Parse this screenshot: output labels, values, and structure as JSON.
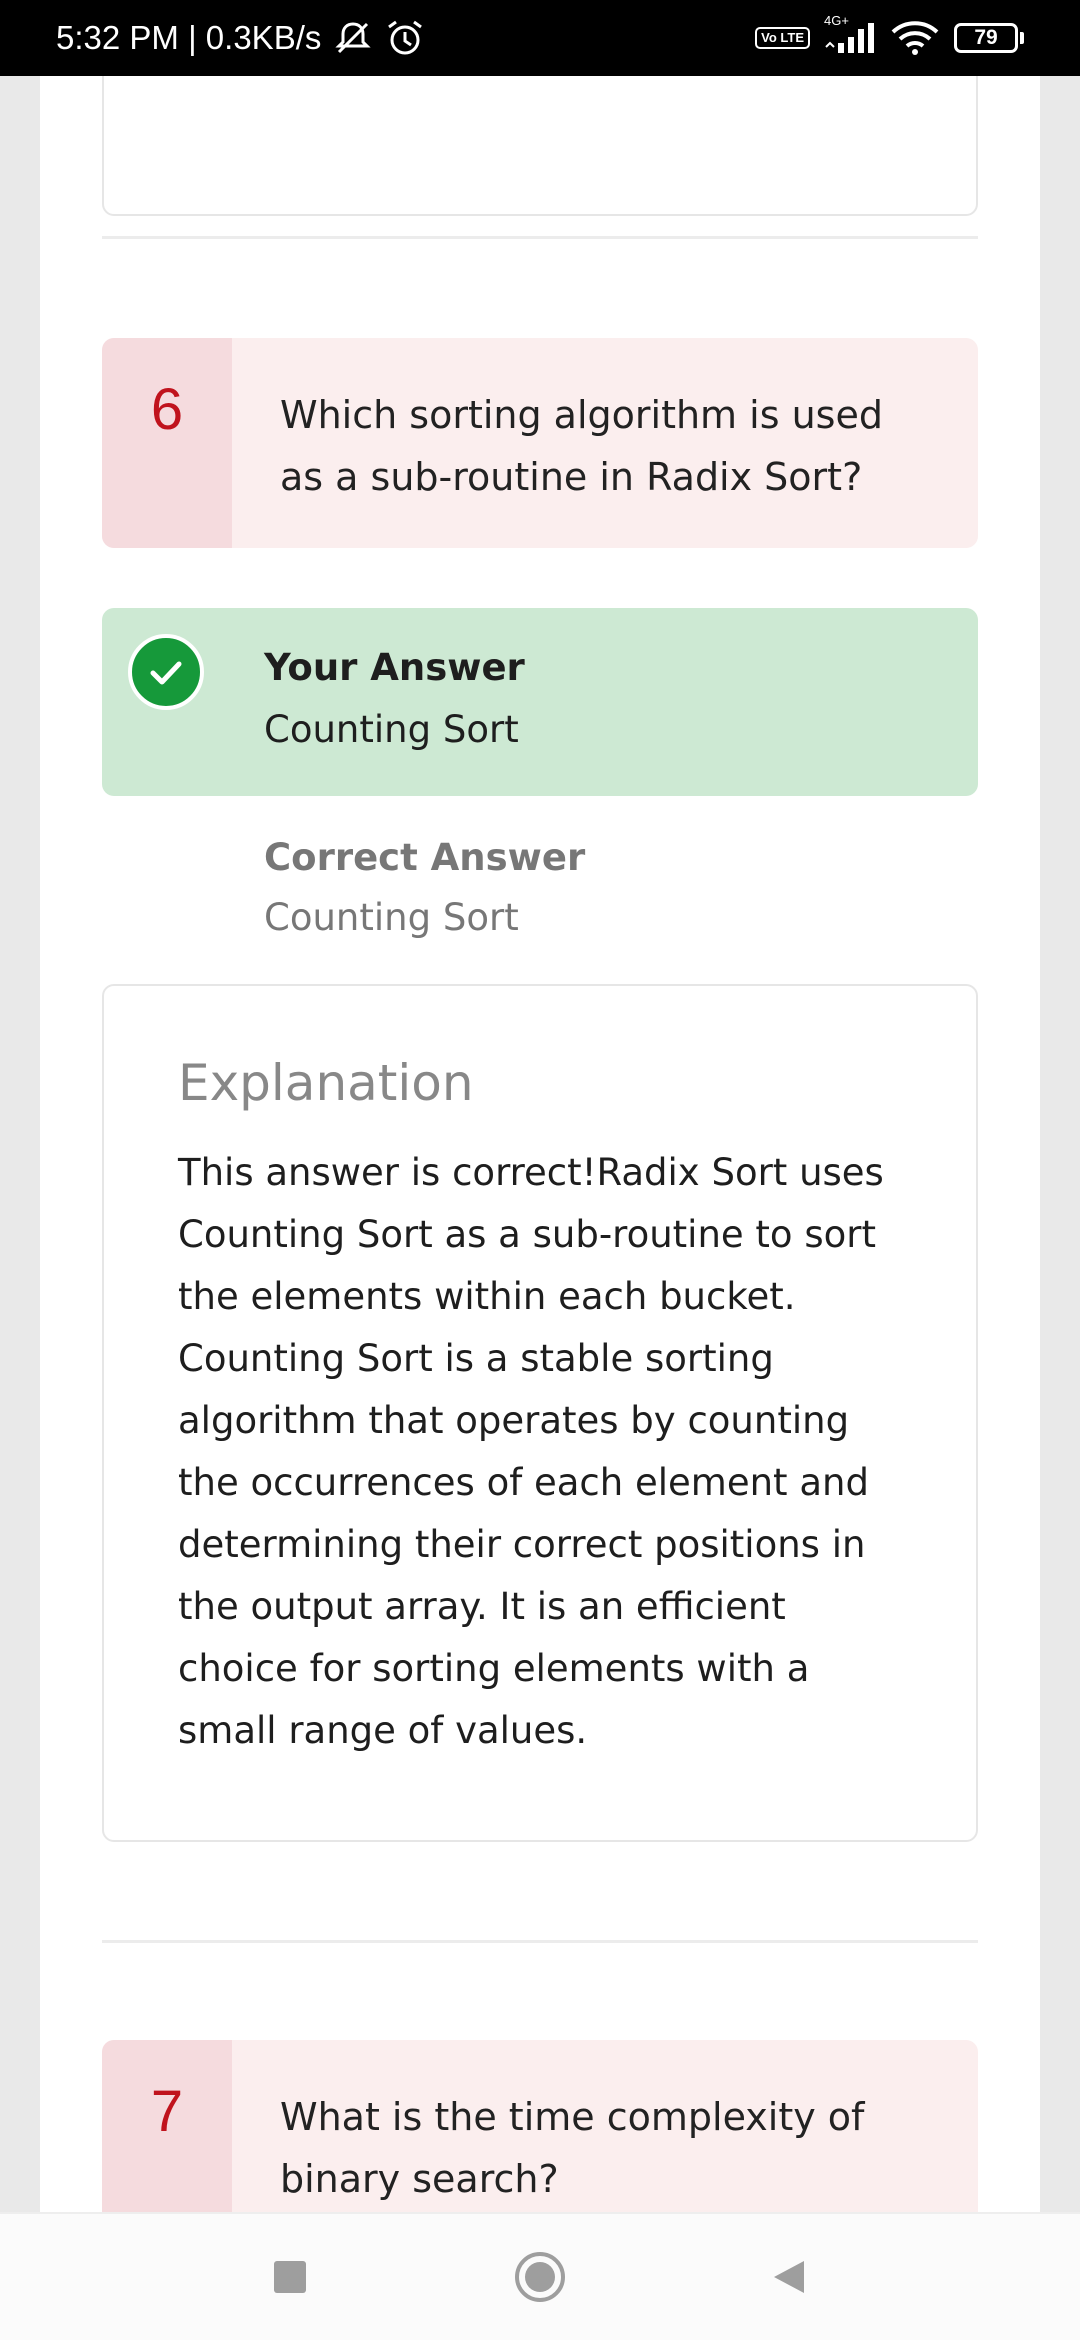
{
  "status_bar": {
    "time_speed": "5:32 PM | 0.3KB/s",
    "network_type": "4G+",
    "volte": "Vo LTE",
    "battery": "79",
    "icons": [
      "mute-icon",
      "alarm-icon",
      "volte-icon",
      "signal-icon",
      "wifi-icon",
      "battery-icon"
    ]
  },
  "question6": {
    "number": "6",
    "text": "Which sorting algorithm is used as a sub-routine in Radix Sort?"
  },
  "your_answer": {
    "label": "Your Answer",
    "value": "Counting Sort",
    "status_icon": "check-icon"
  },
  "correct_answer": {
    "label": "Correct Answer",
    "value": "Counting Sort"
  },
  "explanation": {
    "title": "Explanation",
    "body": "This answer is correct!Radix Sort uses Counting Sort as a sub-routine to sort the elements within each bucket. Counting Sort is a stable sorting algorithm that operates by counting the occurrences of each element and determining their correct positions in the output array. It is an efficient choice for sorting elements with a small range of values."
  },
  "question7": {
    "number": "7",
    "text": "What is the time complexity of binary search?"
  },
  "nav_bar": {
    "icons": [
      "square-icon",
      "home-circle-icon",
      "back-triangle-icon"
    ]
  },
  "colors": {
    "question_bg": "#fbeeee",
    "question_number_bg": "#f5dbde",
    "question_number": "#c0131d",
    "answer_bg": "#cde9d3",
    "check_green": "#16993a"
  }
}
